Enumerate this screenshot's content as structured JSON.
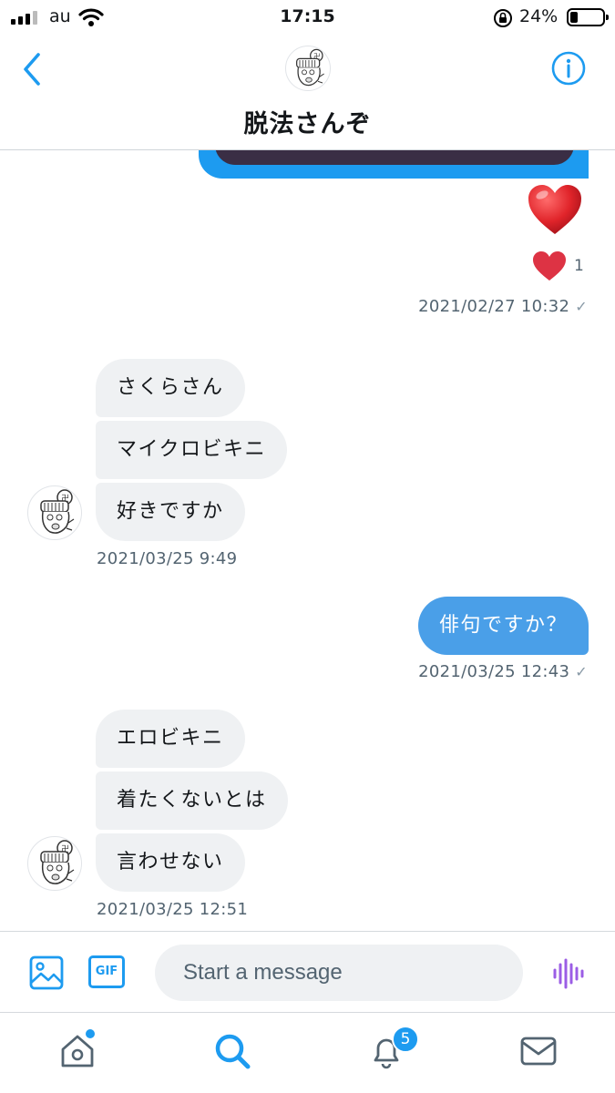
{
  "status_bar": {
    "carrier": "au",
    "time": "17:15",
    "battery_percent": "24%",
    "battery_level": 0.24,
    "icons": [
      "signal-icon",
      "wifi-icon",
      "rotation-lock-icon",
      "battery-icon"
    ]
  },
  "header": {
    "title": "脱法さんぞ",
    "back_icon": "chevron-left-icon",
    "info_icon": "info-icon"
  },
  "messages": {
    "heart_reaction_count": "1",
    "timestamps": {
      "t1": "2021/02/27 10:32",
      "t2": "2021/03/25 9:49",
      "t3": "2021/03/25 12:43",
      "t4": "2021/03/25 12:51"
    },
    "check_mark": "✓",
    "group1": [
      "さくらさん",
      "マイクロビキニ",
      "好きですか"
    ],
    "sent1": "俳句ですか？",
    "group2": [
      "エロビキニ",
      "着たくないとは",
      "言わせない"
    ]
  },
  "composer": {
    "placeholder": "Start a message",
    "gif_label": "GIF",
    "icons": [
      "image-icon",
      "gif-icon",
      "voice-icon"
    ]
  },
  "tabbar": {
    "notifications_badge": "5",
    "icons": [
      "home-icon",
      "search-icon",
      "bell-icon",
      "mail-icon"
    ]
  },
  "colors": {
    "accent": "#1d9bf0",
    "sent_bubble": "#4a9fe8",
    "received_bubble": "#eff1f3",
    "timestamp": "#536471",
    "heart": "#e0245e",
    "voice_icon": "#9b5de5"
  }
}
